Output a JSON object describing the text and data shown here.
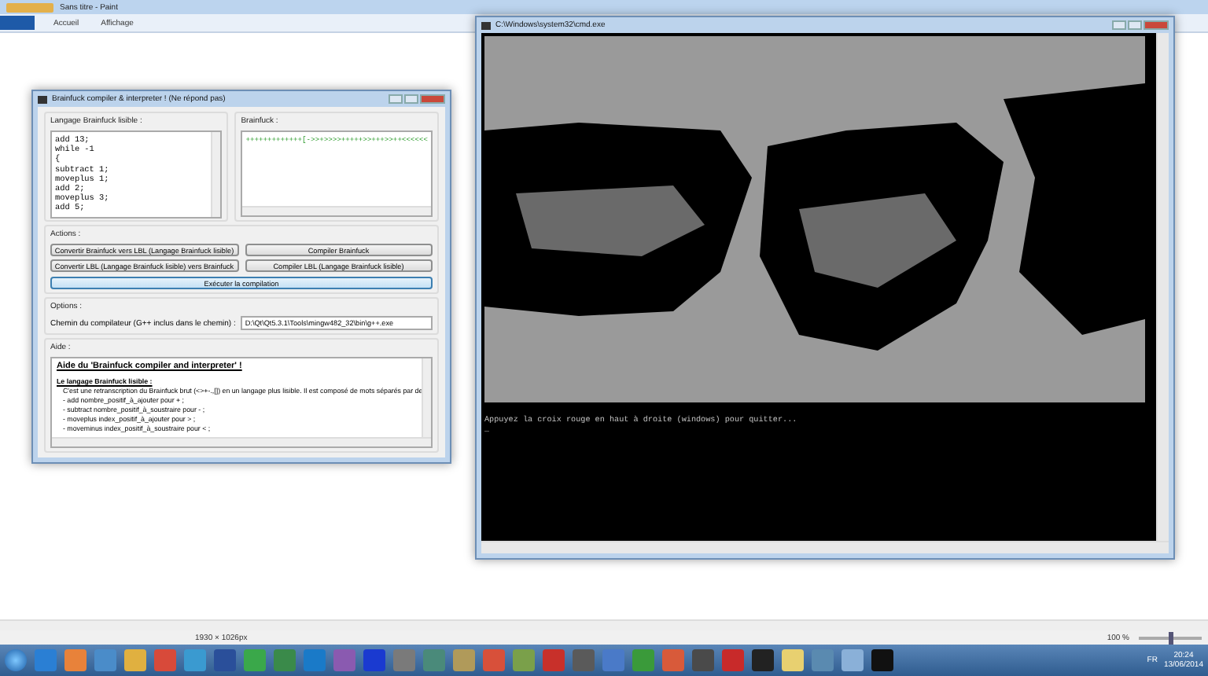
{
  "paint": {
    "title": "Sans titre - Paint",
    "ribbon_tabs": [
      {
        "label": "Accueil"
      },
      {
        "label": "Affichage"
      }
    ],
    "status_bar": {
      "image_size": "1930 × 1026px",
      "zoom": "100 %",
      "zoom_slider": {
        "level": 0.5
      }
    }
  },
  "brainfuck_window": {
    "title": "Brainfuck compiler & interpreter ! (Ne répond pas)",
    "lbl_group": {
      "label": "Langage Brainfuck lisible :",
      "lines": [
        "add 13;",
        "while -1",
        "{",
        "subtract 1;",
        "moveplus 1;",
        "add 2;",
        "moveplus 3;",
        "add 5;"
      ]
    },
    "bf_group": {
      "label": "Brainfuck :",
      "code": "+++++++++++++[->>+>>>>+++++>>+++>>++<<<<<<"
    },
    "actions": {
      "label": "Actions :",
      "buttons": [
        "Convertir Brainfuck vers LBL (Langage Brainfuck lisible)",
        "Compiler Brainfuck",
        "Convertir LBL (Langage Brainfuck lisible) vers Brainfuck",
        "Compiler LBL (Langage Brainfuck lisible)"
      ],
      "run_button": "Exécuter la compilation"
    },
    "options": {
      "label": "Options :",
      "compiler_path_label": "Chemin du compilateur (G++ inclus dans le chemin) :",
      "compiler_path": "D:\\Qt\\Qt5.3.1\\Tools\\mingw482_32\\bin\\g++.exe"
    },
    "help": {
      "label": "Aide :",
      "blocks": [
        {
          "kind": "heading",
          "text": "Aide du 'Brainfuck compiler and interpreter' !"
        },
        {
          "kind": "subheading",
          "text": "Le langage Brainfuck lisible :"
        },
        {
          "kind": "paragraph",
          "text": "C'est une retranscription du Brainfuck brut (<>+-.,[]) en un langage plus lisible. Il est composé de mots séparés par de"
        },
        {
          "kind": "item",
          "text": "- add nombre_positif_à_ajouter pour + ;"
        },
        {
          "kind": "item",
          "text": "- subtract nombre_positif_à_soustraire pour - ;"
        },
        {
          "kind": "item",
          "text": "- moveplus index_positif_à_ajouter pour > ;"
        },
        {
          "kind": "item",
          "text": "- moveminus index_positif_à_soustraire pour < ;"
        }
      ]
    }
  },
  "console_window": {
    "title": "C:\\Windows\\system32\\cmd.exe",
    "output": "Appuyez la croix rouge en haut à droite (windows) pour quitter...",
    "cursor": "_"
  },
  "taskbar": {
    "language": "FR",
    "time": "20:24",
    "date": "13/06/2014"
  }
}
